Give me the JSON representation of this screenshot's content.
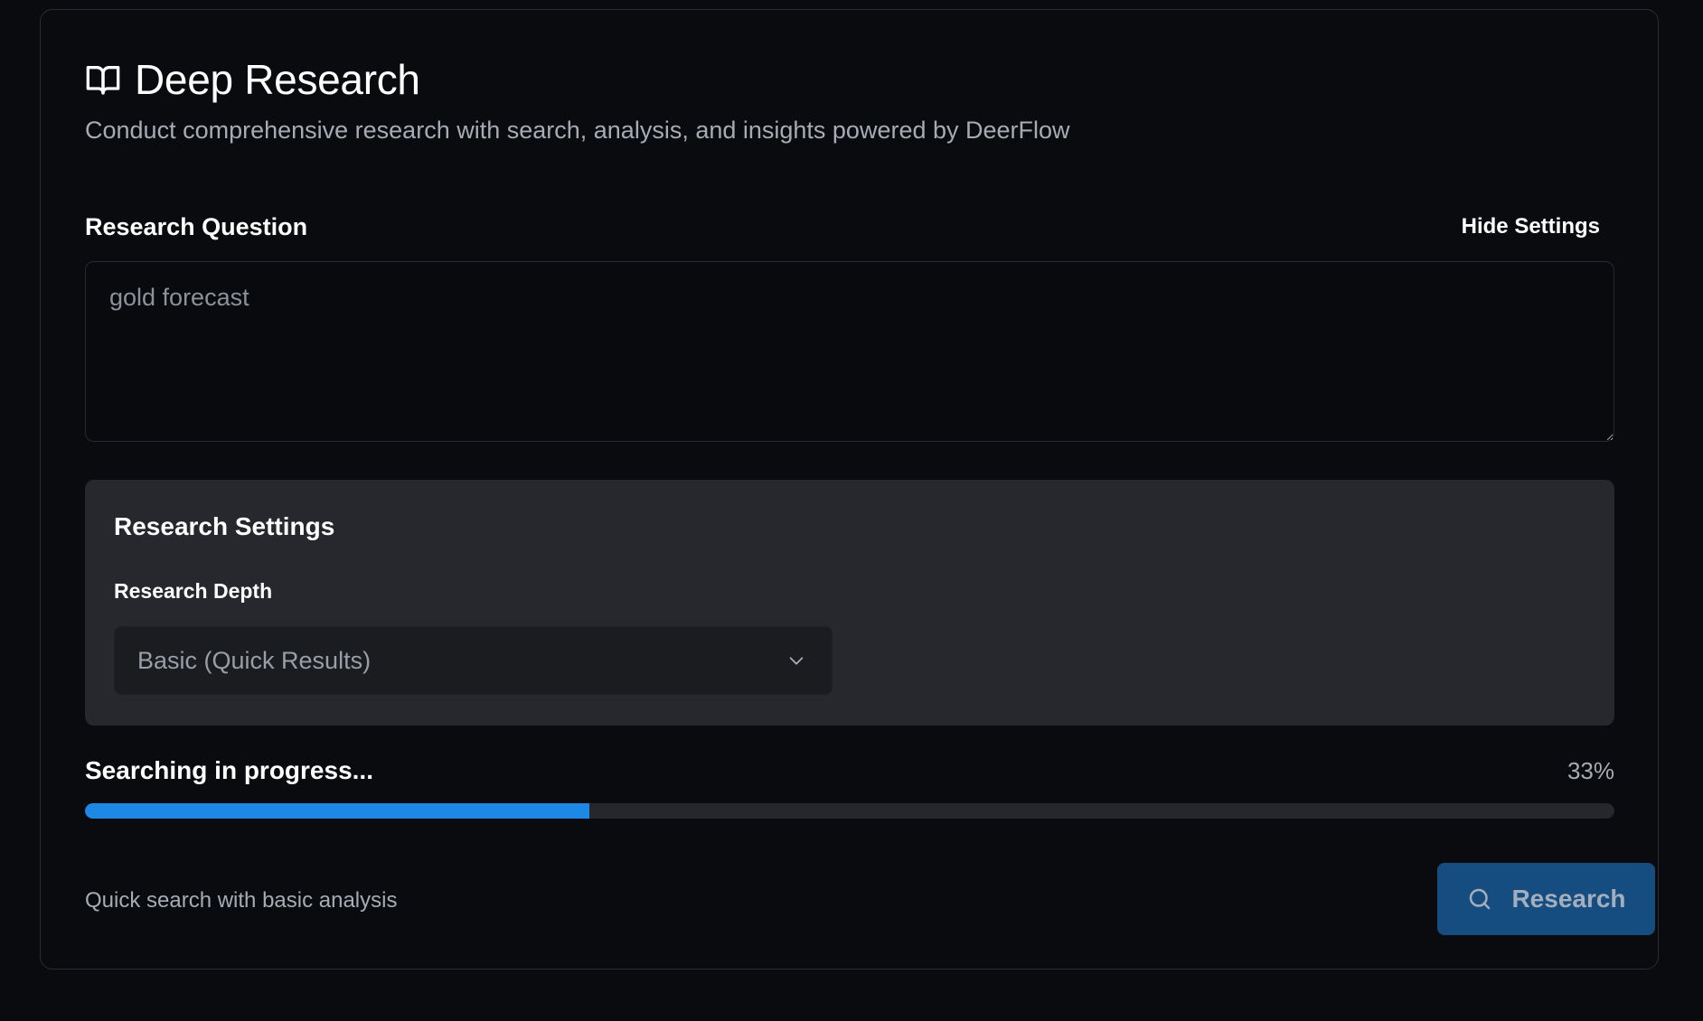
{
  "header": {
    "title": "Deep Research",
    "subtitle": "Conduct comprehensive research with search, analysis, and insights powered by DeerFlow",
    "icon": "book-open-icon"
  },
  "question": {
    "label": "Research Question",
    "toggle_settings_label": "Hide Settings",
    "value": "gold forecast"
  },
  "settings": {
    "title": "Research Settings",
    "depth_label": "Research Depth",
    "depth_selected": "Basic (Quick Results)",
    "dropdown_icon": "chevron-down-icon"
  },
  "progress": {
    "status": "Searching in progress...",
    "percent_label": "33%",
    "fill_fraction": 0.33
  },
  "footer": {
    "note": "Quick search with basic analysis",
    "research_button_label": "Research",
    "research_icon": "search-icon"
  },
  "colors": {
    "background": "#0a0b0e",
    "panel": "#27282d",
    "accent": "#1e88e5",
    "button": "#164d80"
  }
}
